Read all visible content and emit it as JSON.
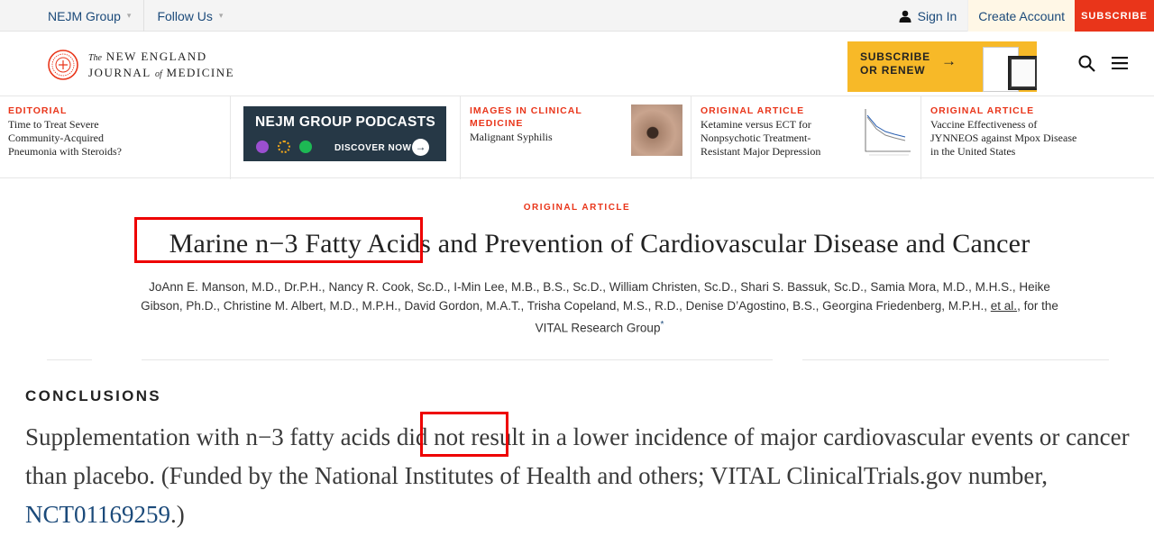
{
  "topbar": {
    "group_label": "NEJM Group",
    "follow_label": "Follow Us",
    "sign_in": "Sign In",
    "create_account": "Create Account",
    "subscribe": "SUBSCRIBE"
  },
  "header": {
    "logo_the": "The",
    "logo_line1": "NEW ENGLAND",
    "logo_line2a": "JOURNAL",
    "logo_of": "of",
    "logo_line2b": "MEDICINE",
    "promo_line1": "SUBSCRIBE",
    "promo_line2": "OR RENEW"
  },
  "strip": {
    "card1": {
      "kicker": "EDITORIAL",
      "title": "Time to Treat Severe Community-Acquired Pneumonia with Steroids?"
    },
    "podcast": {
      "title": "NEJM GROUP PODCASTS",
      "cta": "DISCOVER NOW"
    },
    "card2": {
      "kicker": "IMAGES IN CLINICAL MEDICINE",
      "title": "Malignant Syphilis"
    },
    "card3": {
      "kicker": "ORIGINAL ARTICLE",
      "title": "Ketamine versus ECT for Nonpsychotic Treatment-Resistant Major Depression"
    },
    "card4": {
      "kicker": "ORIGINAL ARTICLE",
      "title": "Vaccine Effectiveness of JYNNEOS against Mpox Disease in the United States"
    }
  },
  "article": {
    "kicker": "ORIGINAL ARTICLE",
    "title": "Marine n−3 Fatty Acids and Prevention of Cardiovascular Disease and Cancer",
    "authors": "JoAnn E. Manson, M.D., Dr.P.H., Nancy R. Cook, Sc.D., I-Min Lee, M.B., B.S., Sc.D., William Christen, Sc.D., Shari S. Bassuk, Sc.D., Samia Mora, M.D., M.H.S., Heike Gibson, Ph.D., Christine M. Albert, M.D., M.P.H., David Gordon, M.A.T., Trisha Copeland, M.S., R.D., Denise D’Agostino, B.S., Georgina Friedenberg, M.P.H., ",
    "et_al": "et al.",
    "authors_tail": ", for the VITAL Research Group",
    "star": "*"
  },
  "conclusions": {
    "label": "CONCLUSIONS",
    "text": "Supplementation with n−3 fatty acids did not result in a lower incidence of major cardiovascular events or cancer than placebo. (Funded by the National Institutes of Health and others; VITAL ClinicalTrials.gov number, ",
    "nct": "NCT01169259",
    "tail": ".)"
  },
  "colors": {
    "accent": "#e9351a",
    "link": "#1b4a7a",
    "promo": "#f7b928",
    "podcast_bg": "#263846",
    "highlight_box": "#e00000"
  }
}
